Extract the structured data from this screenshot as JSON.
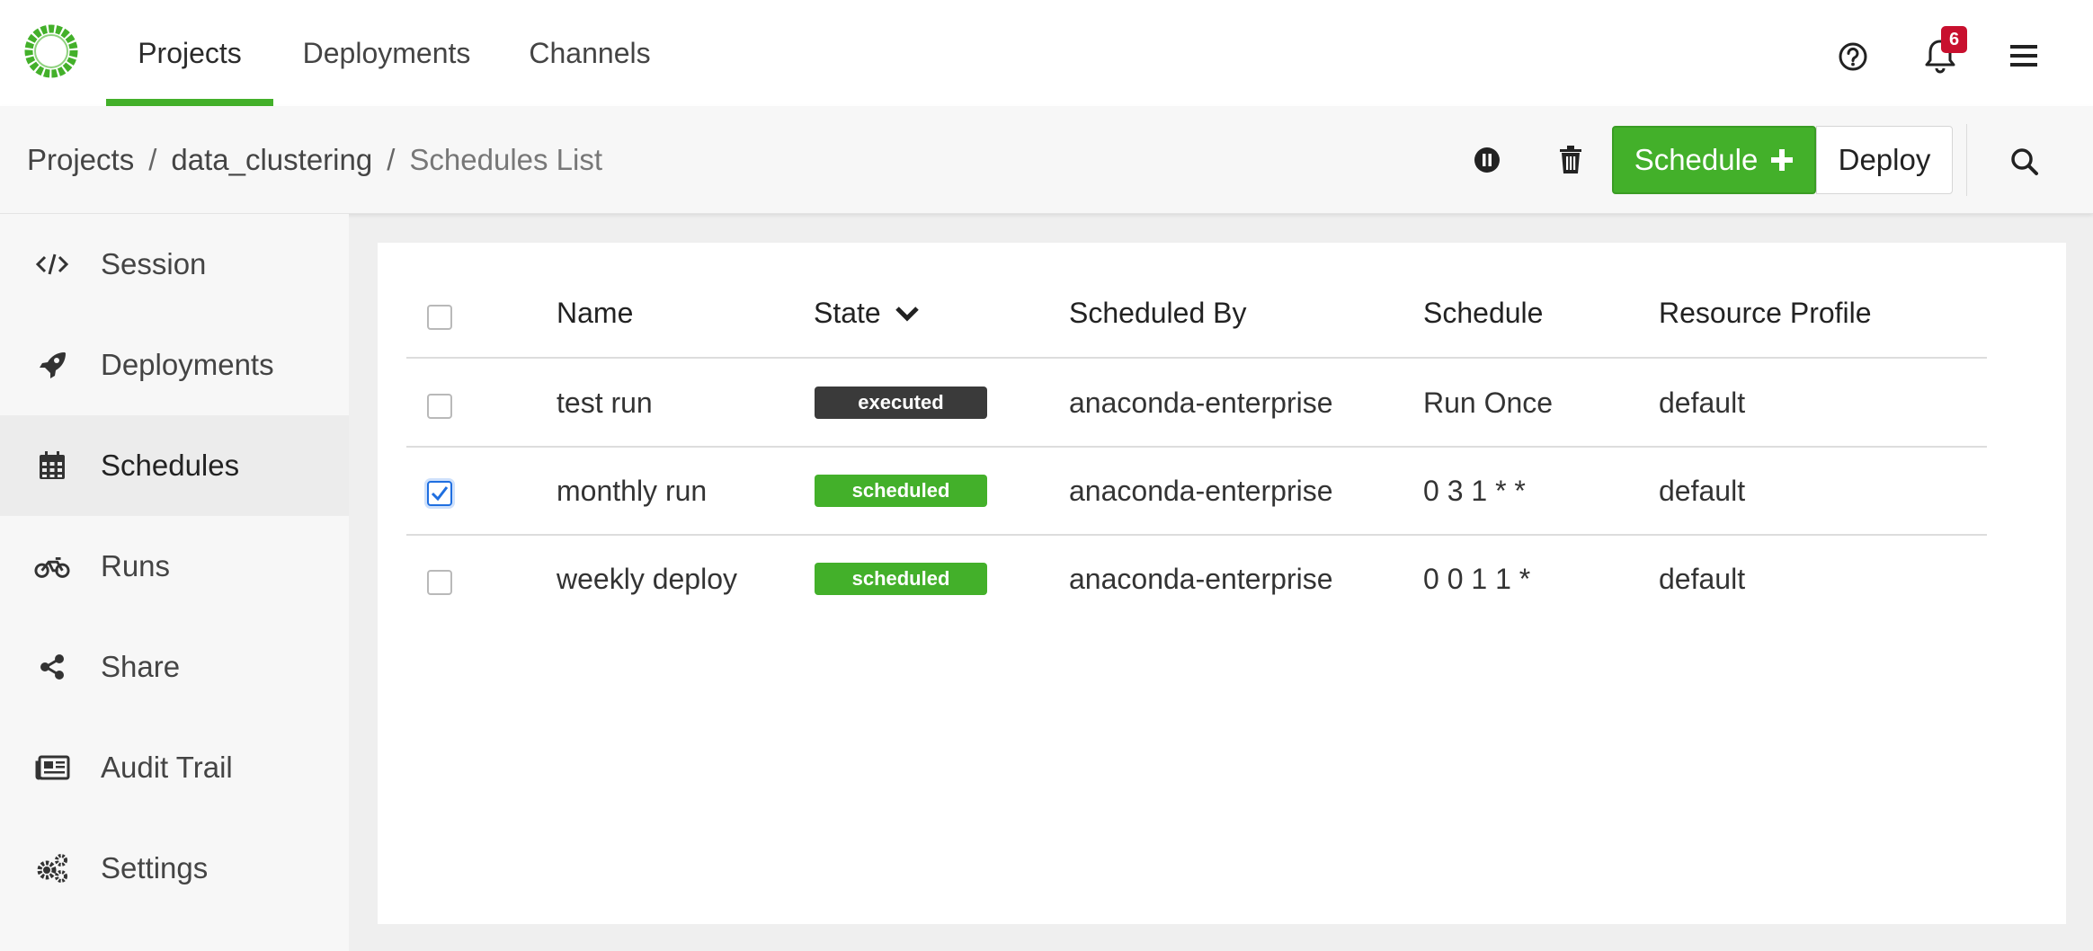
{
  "topnav": {
    "tabs": [
      {
        "label": "Projects",
        "active": true
      },
      {
        "label": "Deployments",
        "active": false
      },
      {
        "label": "Channels",
        "active": false
      }
    ],
    "notification_count": "6",
    "icons": [
      "help-icon",
      "bell-icon",
      "menu-icon"
    ]
  },
  "breadcrumb": {
    "items": [
      "Projects",
      "data_clustering",
      "Schedules List"
    ],
    "separator": "/"
  },
  "toolbar": {
    "schedule_label": "Schedule",
    "deploy_label": "Deploy",
    "icons": [
      "pause-icon",
      "trash-icon",
      "plus-icon",
      "search-icon"
    ]
  },
  "sidebar": {
    "items": [
      {
        "label": "Session",
        "icon": "code-icon"
      },
      {
        "label": "Deployments",
        "icon": "rocket-icon"
      },
      {
        "label": "Schedules",
        "icon": "calendar-icon",
        "active": true
      },
      {
        "label": "Runs",
        "icon": "motorcycle-icon"
      },
      {
        "label": "Share",
        "icon": "share-icon"
      },
      {
        "label": "Audit Trail",
        "icon": "newspaper-icon"
      },
      {
        "label": "Settings",
        "icon": "gears-icon"
      }
    ]
  },
  "table": {
    "columns": [
      "Name",
      "State",
      "Scheduled By",
      "Schedule",
      "Resource Profile"
    ],
    "sort_column": "State",
    "rows": [
      {
        "name": "test run",
        "state": "executed",
        "scheduled_by": "anaconda-enterprise",
        "schedule": "Run Once",
        "resource_profile": "default",
        "checked": false
      },
      {
        "name": "monthly run",
        "state": "scheduled",
        "scheduled_by": "anaconda-enterprise",
        "schedule": "0 3 1 * *",
        "resource_profile": "default",
        "checked": true
      },
      {
        "name": "weekly deploy",
        "state": "scheduled",
        "scheduled_by": "anaconda-enterprise",
        "schedule": "0 0 1 1 *",
        "resource_profile": "default",
        "checked": false
      }
    ]
  },
  "colors": {
    "brand_green": "#43b02a",
    "executed_badge": "#3a3a3a",
    "scheduled_badge": "#43b02a",
    "notification_red": "#c8102e",
    "checkbox_blue": "#1f6fe0"
  }
}
